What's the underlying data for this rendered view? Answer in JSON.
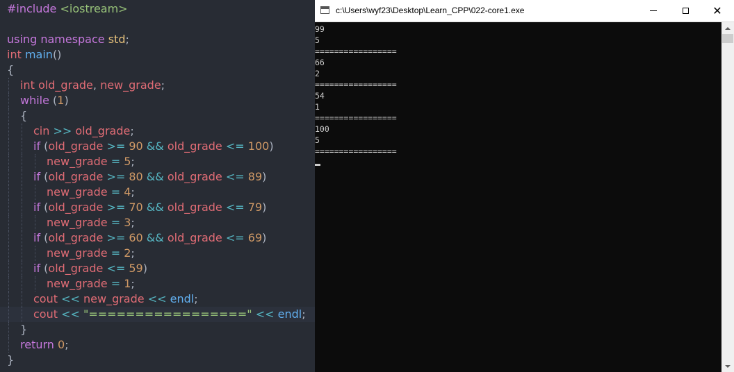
{
  "editor": {
    "lines": [
      {
        "indent": 0,
        "tokens": [
          {
            "t": "#include",
            "c": "pp"
          },
          {
            "t": " ",
            "c": "pl"
          },
          {
            "t": "<iostream>",
            "c": "inc"
          }
        ]
      },
      {
        "indent": 0,
        "tokens": []
      },
      {
        "indent": 0,
        "tokens": [
          {
            "t": "using",
            "c": "kw"
          },
          {
            "t": " ",
            "c": "pl"
          },
          {
            "t": "namespace",
            "c": "kw"
          },
          {
            "t": " ",
            "c": "pl"
          },
          {
            "t": "std",
            "c": "ns"
          },
          {
            "t": ";",
            "c": "pl"
          }
        ]
      },
      {
        "indent": 0,
        "tokens": [
          {
            "t": "int",
            "c": "ty"
          },
          {
            "t": " ",
            "c": "pl"
          },
          {
            "t": "main",
            "c": "fn"
          },
          {
            "t": "()",
            "c": "pl"
          }
        ]
      },
      {
        "indent": 0,
        "tokens": [
          {
            "t": "{",
            "c": "pl"
          }
        ]
      },
      {
        "indent": 1,
        "tokens": [
          {
            "t": "int",
            "c": "ty"
          },
          {
            "t": " ",
            "c": "pl"
          },
          {
            "t": "old_grade",
            "c": "var"
          },
          {
            "t": ", ",
            "c": "pl"
          },
          {
            "t": "new_grade",
            "c": "var"
          },
          {
            "t": ";",
            "c": "pl"
          }
        ]
      },
      {
        "indent": 1,
        "tokens": [
          {
            "t": "while",
            "c": "kw"
          },
          {
            "t": " (",
            "c": "pl"
          },
          {
            "t": "1",
            "c": "num"
          },
          {
            "t": ")",
            "c": "pl"
          }
        ]
      },
      {
        "indent": 1,
        "tokens": [
          {
            "t": "{",
            "c": "pl"
          }
        ]
      },
      {
        "indent": 2,
        "tokens": [
          {
            "t": "cin",
            "c": "var"
          },
          {
            "t": " ",
            "c": "pl"
          },
          {
            "t": ">>",
            "c": "op"
          },
          {
            "t": " ",
            "c": "pl"
          },
          {
            "t": "old_grade",
            "c": "var"
          },
          {
            "t": ";",
            "c": "pl"
          }
        ]
      },
      {
        "indent": 2,
        "tokens": [
          {
            "t": "if",
            "c": "kw"
          },
          {
            "t": " (",
            "c": "pl"
          },
          {
            "t": "old_grade",
            "c": "var"
          },
          {
            "t": " ",
            "c": "pl"
          },
          {
            "t": ">=",
            "c": "op"
          },
          {
            "t": " ",
            "c": "pl"
          },
          {
            "t": "90",
            "c": "num"
          },
          {
            "t": " ",
            "c": "pl"
          },
          {
            "t": "&&",
            "c": "op"
          },
          {
            "t": " ",
            "c": "pl"
          },
          {
            "t": "old_grade",
            "c": "var"
          },
          {
            "t": " ",
            "c": "pl"
          },
          {
            "t": "<=",
            "c": "op"
          },
          {
            "t": " ",
            "c": "pl"
          },
          {
            "t": "100",
            "c": "num"
          },
          {
            "t": ")",
            "c": "pl"
          }
        ]
      },
      {
        "indent": 3,
        "tokens": [
          {
            "t": "new_grade",
            "c": "var"
          },
          {
            "t": " ",
            "c": "pl"
          },
          {
            "t": "=",
            "c": "op"
          },
          {
            "t": " ",
            "c": "pl"
          },
          {
            "t": "5",
            "c": "num"
          },
          {
            "t": ";",
            "c": "pl"
          }
        ]
      },
      {
        "indent": 2,
        "tokens": [
          {
            "t": "if",
            "c": "kw"
          },
          {
            "t": " (",
            "c": "pl"
          },
          {
            "t": "old_grade",
            "c": "var"
          },
          {
            "t": " ",
            "c": "pl"
          },
          {
            "t": ">=",
            "c": "op"
          },
          {
            "t": " ",
            "c": "pl"
          },
          {
            "t": "80",
            "c": "num"
          },
          {
            "t": " ",
            "c": "pl"
          },
          {
            "t": "&&",
            "c": "op"
          },
          {
            "t": " ",
            "c": "pl"
          },
          {
            "t": "old_grade",
            "c": "var"
          },
          {
            "t": " ",
            "c": "pl"
          },
          {
            "t": "<=",
            "c": "op"
          },
          {
            "t": " ",
            "c": "pl"
          },
          {
            "t": "89",
            "c": "num"
          },
          {
            "t": ")",
            "c": "pl"
          }
        ]
      },
      {
        "indent": 3,
        "tokens": [
          {
            "t": "new_grade",
            "c": "var"
          },
          {
            "t": " ",
            "c": "pl"
          },
          {
            "t": "=",
            "c": "op"
          },
          {
            "t": " ",
            "c": "pl"
          },
          {
            "t": "4",
            "c": "num"
          },
          {
            "t": ";",
            "c": "pl"
          }
        ]
      },
      {
        "indent": 2,
        "tokens": [
          {
            "t": "if",
            "c": "kw"
          },
          {
            "t": " (",
            "c": "pl"
          },
          {
            "t": "old_grade",
            "c": "var"
          },
          {
            "t": " ",
            "c": "pl"
          },
          {
            "t": ">=",
            "c": "op"
          },
          {
            "t": " ",
            "c": "pl"
          },
          {
            "t": "70",
            "c": "num"
          },
          {
            "t": " ",
            "c": "pl"
          },
          {
            "t": "&&",
            "c": "op"
          },
          {
            "t": " ",
            "c": "pl"
          },
          {
            "t": "old_grade",
            "c": "var"
          },
          {
            "t": " ",
            "c": "pl"
          },
          {
            "t": "<=",
            "c": "op"
          },
          {
            "t": " ",
            "c": "pl"
          },
          {
            "t": "79",
            "c": "num"
          },
          {
            "t": ")",
            "c": "pl"
          }
        ]
      },
      {
        "indent": 3,
        "tokens": [
          {
            "t": "new_grade",
            "c": "var"
          },
          {
            "t": " ",
            "c": "pl"
          },
          {
            "t": "=",
            "c": "op"
          },
          {
            "t": " ",
            "c": "pl"
          },
          {
            "t": "3",
            "c": "num"
          },
          {
            "t": ";",
            "c": "pl"
          }
        ]
      },
      {
        "indent": 2,
        "tokens": [
          {
            "t": "if",
            "c": "kw"
          },
          {
            "t": " (",
            "c": "pl"
          },
          {
            "t": "old_grade",
            "c": "var"
          },
          {
            "t": " ",
            "c": "pl"
          },
          {
            "t": ">=",
            "c": "op"
          },
          {
            "t": " ",
            "c": "pl"
          },
          {
            "t": "60",
            "c": "num"
          },
          {
            "t": " ",
            "c": "pl"
          },
          {
            "t": "&&",
            "c": "op"
          },
          {
            "t": " ",
            "c": "pl"
          },
          {
            "t": "old_grade",
            "c": "var"
          },
          {
            "t": " ",
            "c": "pl"
          },
          {
            "t": "<=",
            "c": "op"
          },
          {
            "t": " ",
            "c": "pl"
          },
          {
            "t": "69",
            "c": "num"
          },
          {
            "t": ")",
            "c": "pl"
          }
        ]
      },
      {
        "indent": 3,
        "tokens": [
          {
            "t": "new_grade",
            "c": "var"
          },
          {
            "t": " ",
            "c": "pl"
          },
          {
            "t": "=",
            "c": "op"
          },
          {
            "t": " ",
            "c": "pl"
          },
          {
            "t": "2",
            "c": "num"
          },
          {
            "t": ";",
            "c": "pl"
          }
        ]
      },
      {
        "indent": 2,
        "tokens": [
          {
            "t": "if",
            "c": "kw"
          },
          {
            "t": " (",
            "c": "pl"
          },
          {
            "t": "old_grade",
            "c": "var"
          },
          {
            "t": " ",
            "c": "pl"
          },
          {
            "t": "<=",
            "c": "op"
          },
          {
            "t": " ",
            "c": "pl"
          },
          {
            "t": "59",
            "c": "num"
          },
          {
            "t": ")",
            "c": "pl"
          }
        ]
      },
      {
        "indent": 3,
        "tokens": [
          {
            "t": "new_grade",
            "c": "var"
          },
          {
            "t": " ",
            "c": "pl"
          },
          {
            "t": "=",
            "c": "op"
          },
          {
            "t": " ",
            "c": "pl"
          },
          {
            "t": "1",
            "c": "num"
          },
          {
            "t": ";",
            "c": "pl"
          }
        ]
      },
      {
        "indent": 2,
        "tokens": [
          {
            "t": "cout",
            "c": "var"
          },
          {
            "t": " ",
            "c": "pl"
          },
          {
            "t": "<<",
            "c": "op"
          },
          {
            "t": " ",
            "c": "pl"
          },
          {
            "t": "new_grade",
            "c": "var"
          },
          {
            "t": " ",
            "c": "pl"
          },
          {
            "t": "<<",
            "c": "op"
          },
          {
            "t": " ",
            "c": "pl"
          },
          {
            "t": "endl",
            "c": "fn"
          },
          {
            "t": ";",
            "c": "pl"
          }
        ]
      },
      {
        "indent": 2,
        "current": true,
        "tokens": [
          {
            "t": "cout",
            "c": "var"
          },
          {
            "t": " ",
            "c": "pl"
          },
          {
            "t": "<<",
            "c": "op"
          },
          {
            "t": " ",
            "c": "pl"
          },
          {
            "t": "\"=================\"",
            "c": "str"
          },
          {
            "t": " ",
            "c": "pl"
          },
          {
            "t": "<<",
            "c": "op"
          },
          {
            "t": " ",
            "c": "pl"
          },
          {
            "t": "endl",
            "c": "fn"
          },
          {
            "t": ";",
            "c": "pl"
          }
        ]
      },
      {
        "indent": 1,
        "tokens": [
          {
            "t": "}",
            "c": "pl"
          }
        ]
      },
      {
        "indent": 1,
        "tokens": [
          {
            "t": "return",
            "c": "kw"
          },
          {
            "t": " ",
            "c": "pl"
          },
          {
            "t": "0",
            "c": "num"
          },
          {
            "t": ";",
            "c": "pl"
          }
        ]
      },
      {
        "indent": 0,
        "tokens": [
          {
            "t": "}",
            "c": "pl"
          }
        ]
      }
    ]
  },
  "console": {
    "title": "c:\\Users\\wyf23\\Desktop\\Learn_CPP\\022-core1.exe",
    "icons": {
      "app": "console-app-icon",
      "minimize": "minimize-icon",
      "maximize": "maximize-icon",
      "close": "close-icon"
    },
    "close_glyph": "✕",
    "output": "99\n5\n=================\n66\n2\n=================\n54\n1\n=================\n100\n5\n================="
  }
}
